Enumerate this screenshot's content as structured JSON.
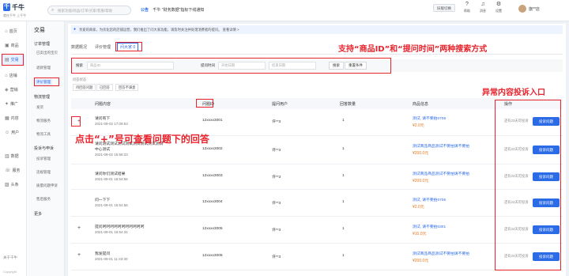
{
  "top": {
    "app_name": "千牛",
    "slogan": "就在千牛 上千牛",
    "search_placeholder": "搜索功能/商品/订单/买家/客服/帮助",
    "notice_tag": "公告",
    "notice_text": "千牛 \"财务数据\"指标下线通知",
    "btn_switch": "旧版切换",
    "icons": [
      {
        "label": "帮助",
        "icon": "help-icon"
      },
      {
        "label": "消息",
        "icon": "bell-icon"
      },
      {
        "label": "设置",
        "icon": "gear-icon"
      }
    ],
    "user_name": "旗**店"
  },
  "leftnav": [
    {
      "label": "首页",
      "icon": "home-icon"
    },
    {
      "label": "商品",
      "icon": "shop-icon"
    },
    {
      "label": "交易",
      "icon": "trade-icon"
    },
    {
      "label": "店铺",
      "icon": "store-icon"
    },
    {
      "label": "营销",
      "icon": "marketing-icon"
    },
    {
      "label": "推广",
      "icon": "promo-icon"
    },
    {
      "label": "内容",
      "icon": "content-icon"
    },
    {
      "label": "用户",
      "icon": "user-icon"
    },
    {
      "label": "数据",
      "icon": "data-icon"
    },
    {
      "label": "服务",
      "icon": "service-icon"
    },
    {
      "label": "头条",
      "icon": "news-icon"
    }
  ],
  "leftnav_footer": {
    "about": "关于千牛",
    "copyright": "Copyright"
  },
  "subnav": {
    "title": "交易",
    "groups": [
      {
        "label": "订单管理",
        "items": [
          "已卖出的宝贝",
          "退款管理",
          "评价管理"
        ]
      },
      {
        "label": "物流管理",
        "items": [
          "发货",
          "物流服务",
          "物流工具"
        ]
      },
      {
        "label": "投诉与申诉",
        "items": [
          "投诉管理",
          "违规管理",
          "质量问题申诉",
          "售后服务"
        ]
      }
    ],
    "more": "更多"
  },
  "main": {
    "banner": "亲爱的商家，为优化您的店铺运营，我们推出了问大家功能，请及时关注并处理消费者的提问。 查看详情 >",
    "tabs": [
      "数据概况",
      "评价管理",
      "问大家"
    ],
    "tab_badge": "0",
    "filter": {
      "search_label": "搜索",
      "search_placeholder": "商品ID",
      "time_label": "提问时间",
      "start_placeholder": "开始日期",
      "end_placeholder": "结束日期",
      "search_btn": "搜索",
      "reset_btn": "重置条件"
    },
    "status_label": "问答状态",
    "chips": [
      "待回答问题",
      "已回答",
      "回答不满意"
    ],
    "columns": [
      "问题内容",
      "问题ID",
      "提问用户",
      "回答数量",
      "商品信息",
      "操作"
    ],
    "rows": [
      {
        "expand": "+",
        "question": "请问有下",
        "time": "2021-09-02 17:09:53",
        "qid": "12xxxx3001",
        "user": "许**3",
        "answers": "1",
        "product": "测试, 请不要拍0706",
        "price": "¥2.0元",
        "op_info": "还有23天可投诉",
        "op_btn": "投诉问题"
      },
      {
        "expand": "",
        "question": "请问测试测试测试测试测试测试测试测试",
        "question2": "中心测试",
        "time": "2021-09-02 15:58:23",
        "qid": "12xxxx3002",
        "user": "许**3",
        "answers": "1",
        "product": "测试商品商品测试不要拍请不要拍",
        "price": "¥200.0元",
        "op_info": "还有23天可投诉",
        "op_btn": "投诉问题"
      },
      {
        "expand": "",
        "question": "请问你们测试结果",
        "time": "2021-09-01 16:54:56",
        "qid": "12xxxx3003",
        "user": "许**3",
        "answers": "1",
        "product": "测试商品商品测试不要拍请不要拍",
        "price": "¥200.0元",
        "op_info": "还有23天可投诉",
        "op_btn": "投诉问题"
      },
      {
        "expand": "",
        "question": "问一下下",
        "time": "2021-09-01 16:54:56",
        "qid": "12xxxx3004",
        "user": "许**3",
        "answers": "1",
        "product": "测试, 请不要拍0706",
        "price": "¥2.0元",
        "op_info": "还有24天可投诉",
        "op_btn": "投诉问题"
      },
      {
        "expand": "+",
        "question": "提问呵呵呵呵呵呵呵呵呵呵呵",
        "time": "2021-09-01 16:54:31",
        "qid": "12xxxx3005",
        "user": "许**3",
        "answers": "1",
        "product": "测试, 请不要拍0301",
        "price": "¥10.0元",
        "op_info": "还有24天可投诉",
        "op_btn": "投诉问题"
      },
      {
        "expand": "+",
        "question": "我发提问",
        "time": "2021-09-01 11:43:30",
        "qid": "12xxxx3006",
        "user": "许**3",
        "answers": "1",
        "product": "测试商品商品测试不要拍请不要拍",
        "price": "¥200.0元",
        "op_info": "还有24天可投诉",
        "op_btn": "投诉问题"
      }
    ]
  },
  "annotations": {
    "search": "支持“商品ID”和“提问时间”两种搜索方式",
    "complaint": "异常内容投诉入口",
    "expand": "点击“+”号可查看问题下的回答"
  },
  "colors": {
    "accent": "#2b6be6",
    "annotation": "#e8232c",
    "price": "#e8771c"
  }
}
